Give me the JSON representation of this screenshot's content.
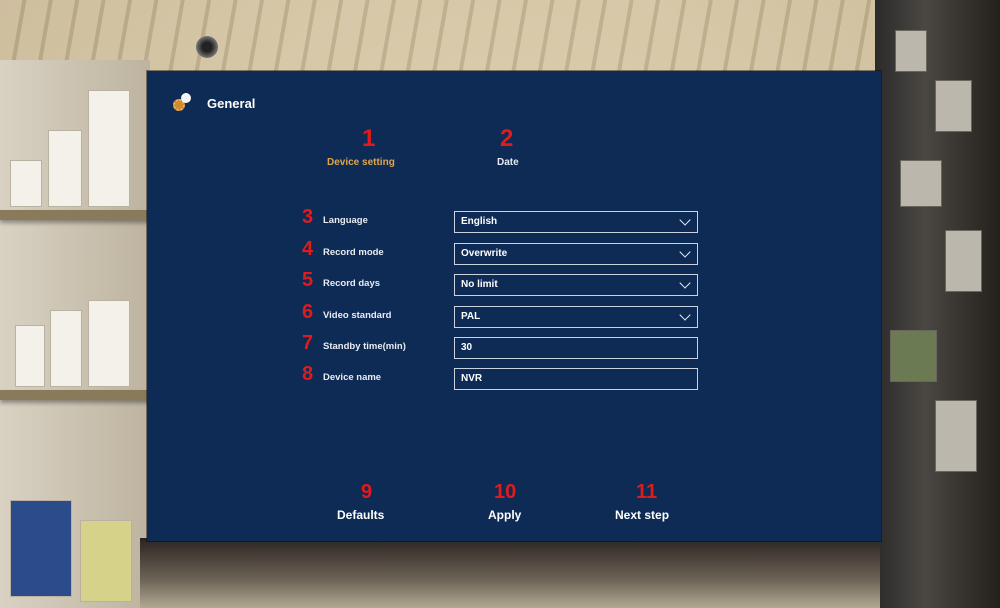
{
  "window": {
    "title": "General",
    "icon": "gear-icon"
  },
  "tabs": [
    {
      "label": "Device setting",
      "number": "1",
      "active": true
    },
    {
      "label": "Date",
      "number": "2",
      "active": false
    }
  ],
  "form": {
    "language": {
      "number": "3",
      "label": "Language",
      "value": "English",
      "type": "select"
    },
    "record_mode": {
      "number": "4",
      "label": "Record mode",
      "value": "Overwrite",
      "type": "select"
    },
    "record_days": {
      "number": "5",
      "label": "Record days",
      "value": "No limit",
      "type": "select"
    },
    "video_standard": {
      "number": "6",
      "label": "Video standard",
      "value": "PAL",
      "type": "select"
    },
    "standby_time": {
      "number": "7",
      "label": "Standby time(min)",
      "value": "30",
      "type": "input"
    },
    "device_name": {
      "number": "8",
      "label": "Device name",
      "value": "NVR",
      "type": "input"
    }
  },
  "buttons": {
    "defaults": {
      "number": "9",
      "label": "Defaults"
    },
    "apply": {
      "number": "10",
      "label": "Apply"
    },
    "next_step": {
      "number": "11",
      "label": "Next step"
    }
  },
  "colors": {
    "panel": "#0d2b55",
    "active_tab": "#e0a64a",
    "annotation": "#e11b1b",
    "text": "#ffffff"
  }
}
